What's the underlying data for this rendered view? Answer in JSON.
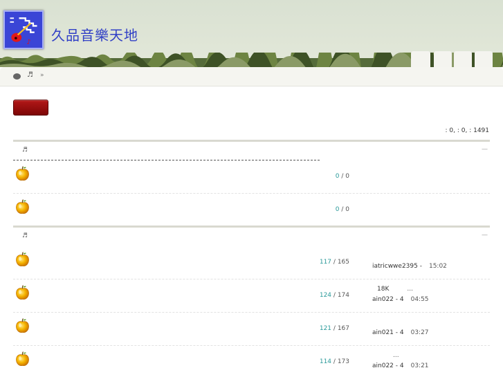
{
  "site": {
    "title": "久品音樂天地"
  },
  "breadcrumb": {
    "note_glyph": "♬",
    "separator": "»"
  },
  "stats": {
    "text": ": 0,   : 0,   : 1491"
  },
  "sections": [
    {
      "note_glyph": "♬",
      "toggle": "—",
      "forums": [
        {
          "threads": "0",
          "posts": "0",
          "last_top": "",
          "last_user": "",
          "last_time": ""
        },
        {
          "threads": "0",
          "posts": "0",
          "last_top": "",
          "last_user": "",
          "last_time": ""
        }
      ]
    },
    {
      "note_glyph": "♬",
      "toggle": "—",
      "forums": [
        {
          "threads": "117",
          "posts": "165",
          "last_top": "",
          "last_user": "iatricwwe2395 -",
          "last_time": "15:02"
        },
        {
          "threads": "124",
          "posts": "174",
          "last_top": "18K",
          "last_top_ell": "...",
          "last_user": "ain022 - 4",
          "last_time": "04:55"
        },
        {
          "threads": "121",
          "posts": "167",
          "last_top": "",
          "last_user": "ain021 - 4",
          "last_time": "03:27"
        },
        {
          "threads": "114",
          "posts": "173",
          "last_top": "",
          "last_top_ell": "...",
          "last_user": "ain022 - 4",
          "last_time": "03:21"
        }
      ]
    }
  ]
}
